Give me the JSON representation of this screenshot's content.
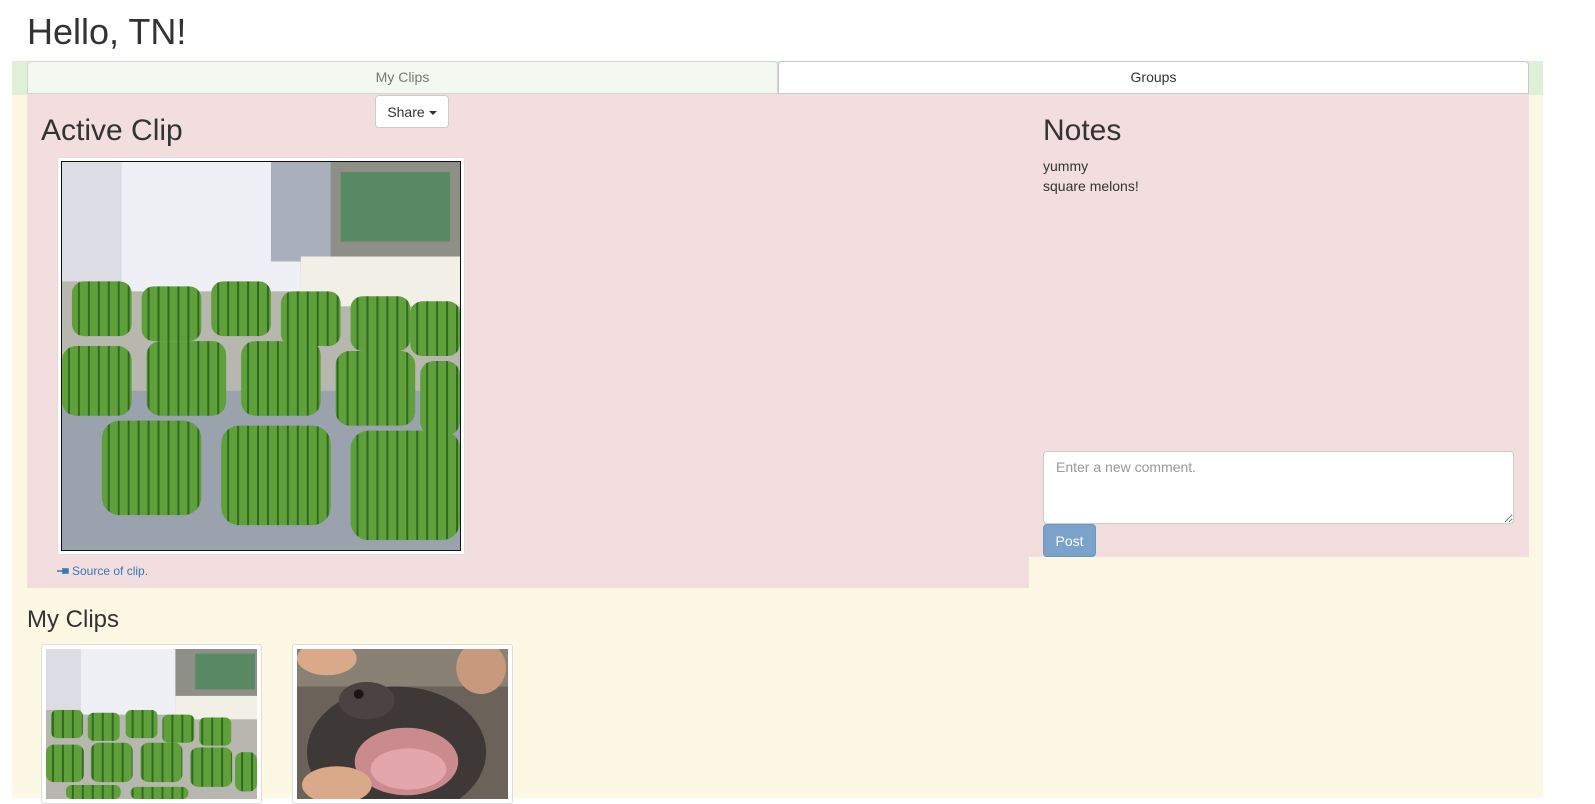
{
  "header": {
    "greeting": "Hello, TN!"
  },
  "tabs": [
    {
      "label": "My Clips",
      "active": false
    },
    {
      "label": "Groups",
      "active": true
    }
  ],
  "share": {
    "label": "Share"
  },
  "active_clip": {
    "heading": "Active Clip",
    "image": "square-watermelons-photo",
    "source_link": "Source of clip."
  },
  "notes": {
    "heading": "Notes",
    "items": [
      "yummy",
      "square melons!"
    ],
    "comment_placeholder": "Enter a new comment.",
    "post_label": "Post"
  },
  "my_clips": {
    "heading": "My Clips",
    "items": [
      {
        "image": "square-watermelons-photo"
      },
      {
        "image": "baby-hippo-photo"
      }
    ]
  },
  "colors": {
    "panel_pink": "#f2dede",
    "background_cream": "#fcf8e3",
    "strip_green": "#dff0d8",
    "link_blue": "#337ab7",
    "post_button": "#7ba2c9"
  }
}
